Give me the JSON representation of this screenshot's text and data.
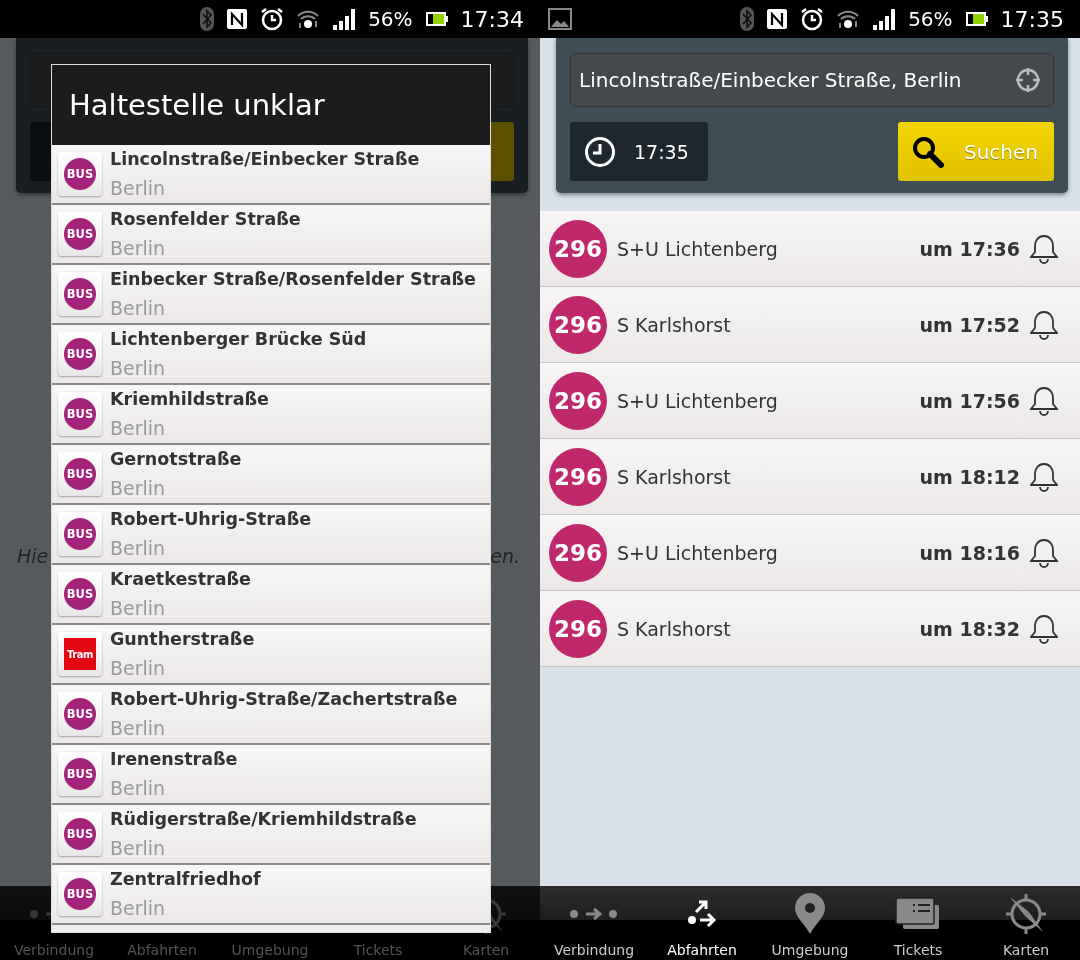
{
  "left_screen": {
    "status_bar": {
      "notification_icon": false,
      "battery": "56%",
      "time": "17:34"
    },
    "background_hint": [
      "Hie",
      "en."
    ],
    "dialog": {
      "title": "Haltestelle unklar",
      "items": [
        {
          "kind": "bus",
          "badge": "BUS",
          "name": "Lincolnstraße/Einbecker Straße",
          "city": "Berlin"
        },
        {
          "kind": "bus",
          "badge": "BUS",
          "name": "Rosenfelder Straße",
          "city": "Berlin"
        },
        {
          "kind": "bus",
          "badge": "BUS",
          "name": "Einbecker Straße/Rosenfelder Straße",
          "city": "Berlin"
        },
        {
          "kind": "bus",
          "badge": "BUS",
          "name": "Lichtenberger Brücke Süd",
          "city": "Berlin"
        },
        {
          "kind": "bus",
          "badge": "BUS",
          "name": "Kriemhildstraße",
          "city": "Berlin"
        },
        {
          "kind": "bus",
          "badge": "BUS",
          "name": "Gernotstraße",
          "city": "Berlin"
        },
        {
          "kind": "bus",
          "badge": "BUS",
          "name": "Robert-Uhrig-Straße",
          "city": "Berlin"
        },
        {
          "kind": "bus",
          "badge": "BUS",
          "name": "Kraetkestraße",
          "city": "Berlin"
        },
        {
          "kind": "tram",
          "badge": "Tram",
          "name": "Guntherstraße",
          "city": "Berlin"
        },
        {
          "kind": "bus",
          "badge": "BUS",
          "name": "Robert-Uhrig-Straße/Zachertstraße",
          "city": "Berlin"
        },
        {
          "kind": "bus",
          "badge": "BUS",
          "name": "Irenenstraße",
          "city": "Berlin"
        },
        {
          "kind": "bus",
          "badge": "BUS",
          "name": "Rüdigerstraße/Kriemhildstraße",
          "city": "Berlin"
        },
        {
          "kind": "bus",
          "badge": "BUS",
          "name": "Zentralfriedhof",
          "city": "Berlin"
        }
      ]
    },
    "nav": [
      {
        "label": "Verbindung",
        "selected": false
      },
      {
        "label": "Abfahrten",
        "selected": false
      },
      {
        "label": "Umgebung",
        "selected": false
      },
      {
        "label": "Tickets",
        "selected": false
      },
      {
        "label": "Karten",
        "selected": false
      }
    ]
  },
  "right_screen": {
    "status_bar": {
      "notification_icon": true,
      "battery": "56%",
      "time": "17:35"
    },
    "search": {
      "value": "Lincolnstraße/Einbecker Straße, Berlin",
      "time": "17:35",
      "button": "Suchen"
    },
    "departures": [
      {
        "line": "296",
        "destination": "S+U Lichtenberg",
        "time": "um 17:36"
      },
      {
        "line": "296",
        "destination": "S Karlshorst",
        "time": "um 17:52"
      },
      {
        "line": "296",
        "destination": "S+U Lichtenberg",
        "time": "um 17:56"
      },
      {
        "line": "296",
        "destination": "S Karlshorst",
        "time": "um 18:12"
      },
      {
        "line": "296",
        "destination": "S+U Lichtenberg",
        "time": "um 18:16"
      },
      {
        "line": "296",
        "destination": "S Karlshorst",
        "time": "um 18:32"
      }
    ],
    "nav": [
      {
        "label": "Verbindung",
        "selected": false
      },
      {
        "label": "Abfahrten",
        "selected": true
      },
      {
        "label": "Umgebung",
        "selected": false
      },
      {
        "label": "Tickets",
        "selected": false
      },
      {
        "label": "Karten",
        "selected": false
      }
    ]
  }
}
